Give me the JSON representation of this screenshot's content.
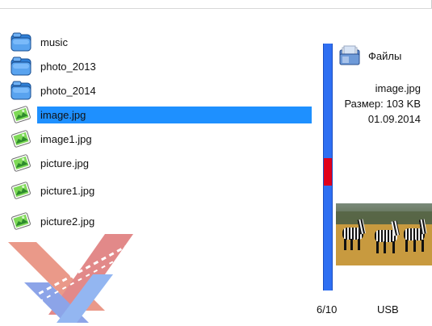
{
  "files": [
    {
      "name": "music",
      "type": "folder"
    },
    {
      "name": "photo_2013",
      "type": "folder"
    },
    {
      "name": "photo_2014",
      "type": "folder"
    },
    {
      "name": "image.jpg",
      "type": "image",
      "selected": true
    },
    {
      "name": "image1.jpg",
      "type": "image"
    },
    {
      "name": "picture.jpg",
      "type": "image"
    },
    {
      "name": "picture1.jpg",
      "type": "image"
    },
    {
      "name": "picture2.jpg",
      "type": "image"
    }
  ],
  "panel": {
    "title": "Файлы",
    "selected_name": "image.jpg",
    "size_text": "Размер: 103 KB",
    "date": "01.09.2014"
  },
  "scrollbar": {
    "position": 6,
    "total": 10
  },
  "status": {
    "counter": "6/10",
    "device": "USB"
  },
  "colors": {
    "selection": "#1e90ff",
    "scroll_track": "#2f6ff2",
    "scroll_thumb": "#e0001b"
  }
}
